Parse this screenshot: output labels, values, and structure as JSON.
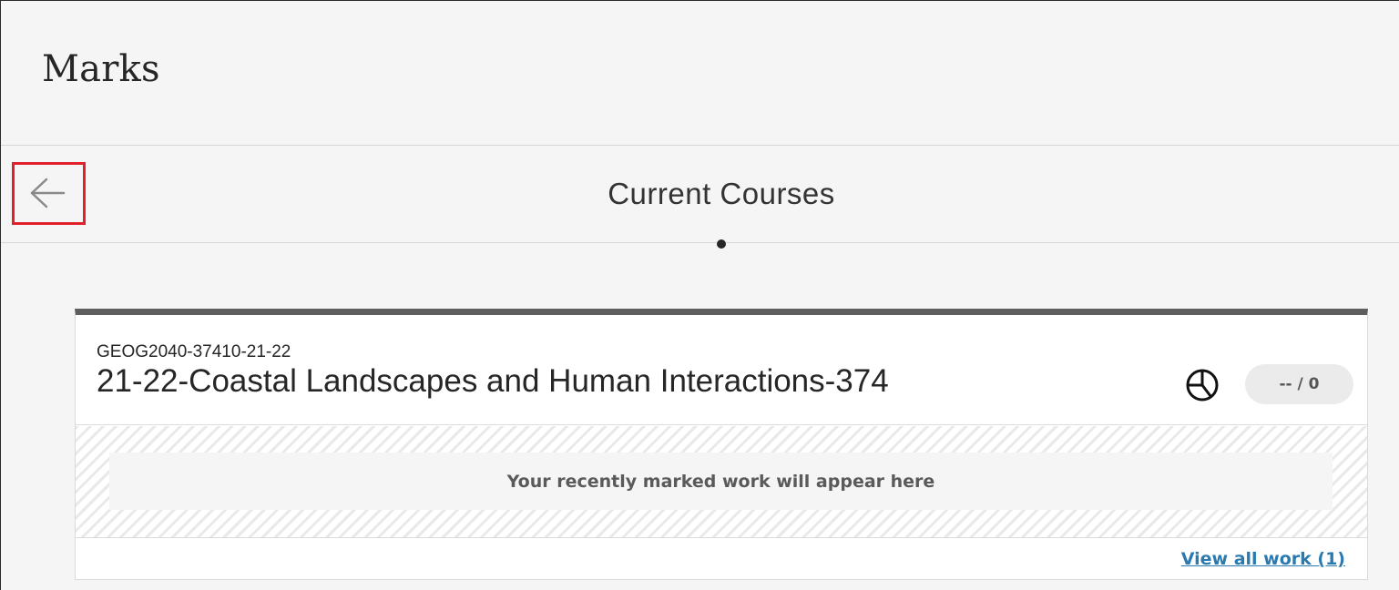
{
  "page": {
    "title": "Marks"
  },
  "nav": {
    "back_icon": "arrow-left-icon",
    "title": "Current Courses"
  },
  "course": {
    "code": "GEOG2040-37410-21-22",
    "name": "21-22-Coastal Landscapes and Human Interactions-374",
    "progress_icon": "pie-progress-icon",
    "grade": "-- / 0",
    "recent_placeholder": "Your recently marked work will appear here",
    "view_all_label": "View all work (1)"
  },
  "colors": {
    "highlight_border": "#e0202a",
    "link": "#2a7ab0",
    "card_top_border": "#5e5e5e"
  }
}
